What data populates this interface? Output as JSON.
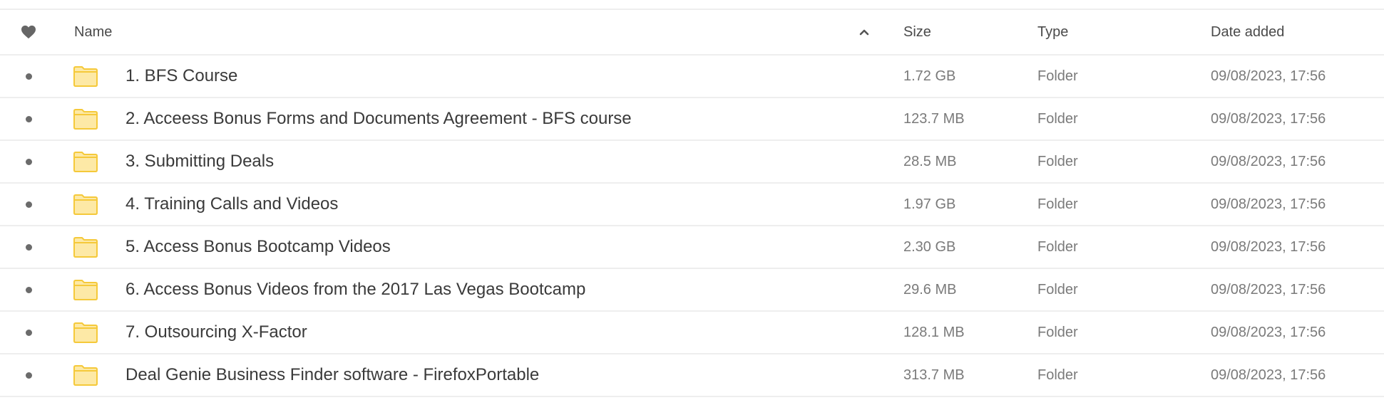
{
  "header": {
    "favorite_icon": "heart-icon",
    "name": "Name",
    "sort_icon": "chevron-up-icon",
    "size": "Size",
    "type": "Type",
    "date_added": "Date added"
  },
  "colors": {
    "folder_fill": "#FDE9A6",
    "folder_stroke": "#F5C93A",
    "divider": "#EEEEEE",
    "icon_gray": "#6B6B6B"
  },
  "rows": [
    {
      "name": "1. BFS Course",
      "size": "1.72 GB",
      "type": "Folder",
      "date": "09/08/2023, 17:56",
      "icon": "folder-icon"
    },
    {
      "name": "2. Acceess Bonus Forms and Documents Agreement - BFS course",
      "size": "123.7 MB",
      "type": "Folder",
      "date": "09/08/2023, 17:56",
      "icon": "folder-icon"
    },
    {
      "name": "3. Submitting Deals",
      "size": "28.5 MB",
      "type": "Folder",
      "date": "09/08/2023, 17:56",
      "icon": "folder-icon"
    },
    {
      "name": "4. Training Calls and Videos",
      "size": "1.97 GB",
      "type": "Folder",
      "date": "09/08/2023, 17:56",
      "icon": "folder-icon"
    },
    {
      "name": "5. Access Bonus Bootcamp Videos",
      "size": "2.30 GB",
      "type": "Folder",
      "date": "09/08/2023, 17:56",
      "icon": "folder-icon"
    },
    {
      "name": "6. Access Bonus Videos from the 2017 Las Vegas Bootcamp",
      "size": "29.6 MB",
      "type": "Folder",
      "date": "09/08/2023, 17:56",
      "icon": "folder-icon"
    },
    {
      "name": "7. Outsourcing X-Factor",
      "size": "128.1 MB",
      "type": "Folder",
      "date": "09/08/2023, 17:56",
      "icon": "folder-icon"
    },
    {
      "name": "Deal Genie Business Finder software - FirefoxPortable",
      "size": "313.7 MB",
      "type": "Folder",
      "date": "09/08/2023, 17:56",
      "icon": "folder-icon"
    }
  ]
}
